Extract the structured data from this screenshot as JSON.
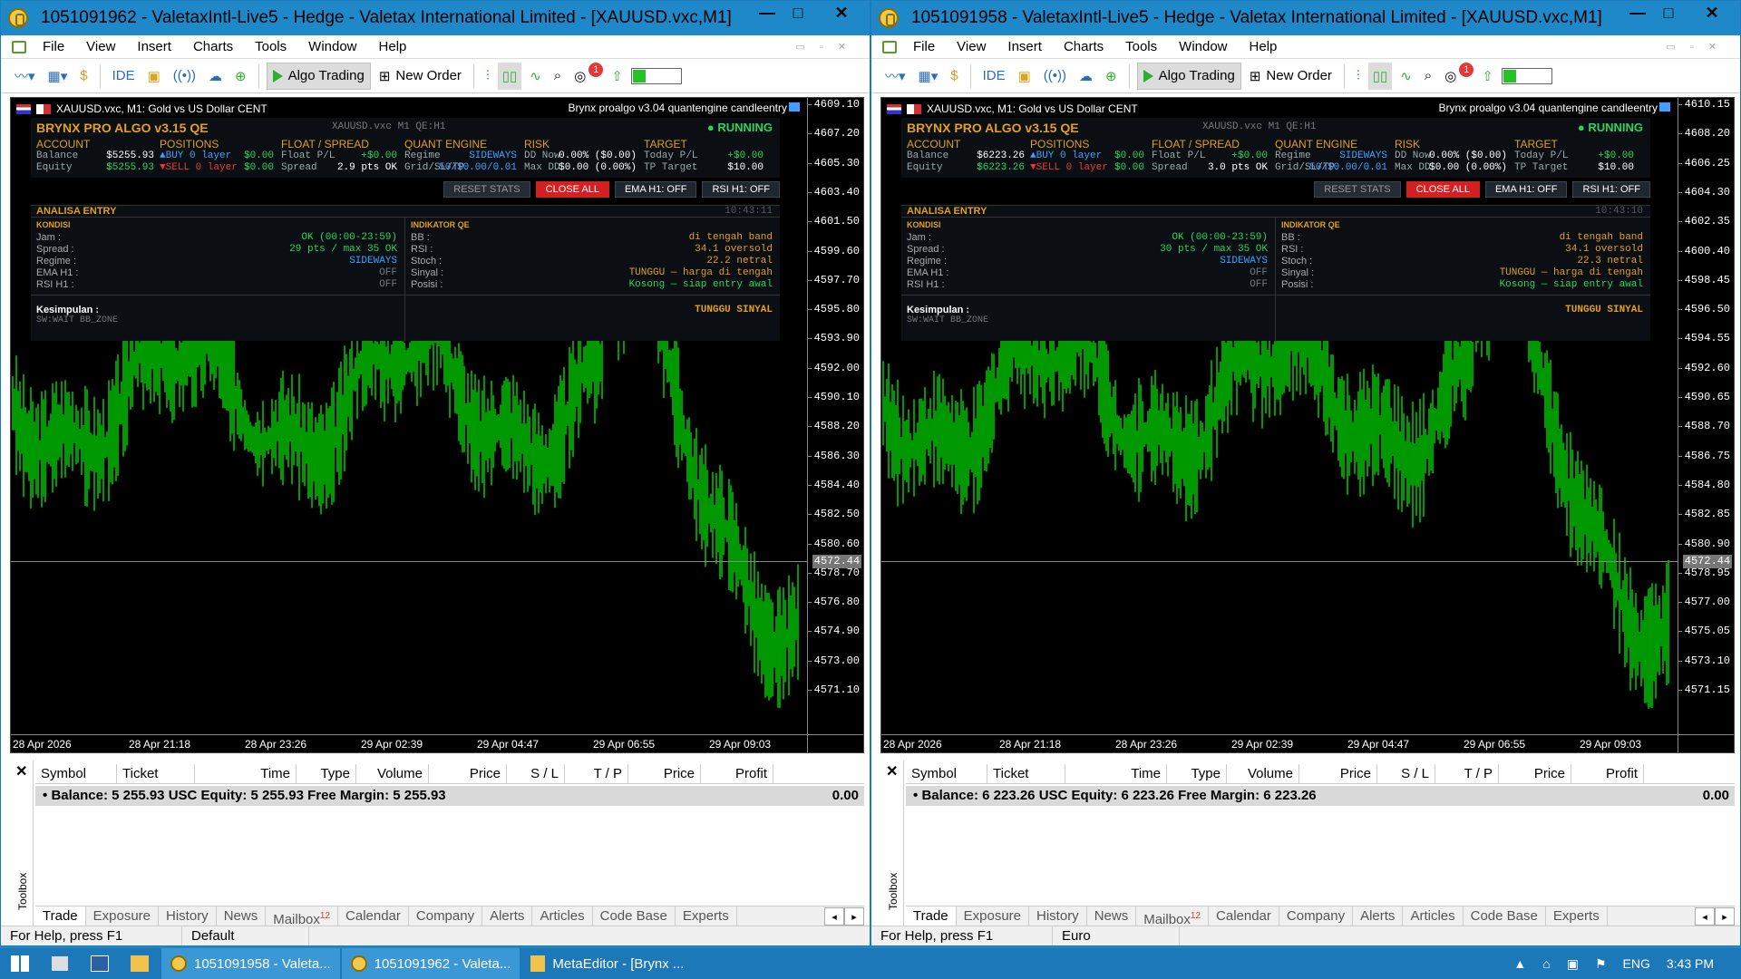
{
  "windows": [
    {
      "title": "1051091962 - ValetaxIntl-Live5 - Hedge - Valetax International Limited - [XAUUSD.vxc,M1]",
      "chart_header": "XAUUSD.vxc, M1:  Gold vs US Dollar CENT",
      "ea_name": "Brynx proalgo v3.04 quantengine candleentry",
      "status_help": "For Help, press F1",
      "status_profile": "Default",
      "current_price": "4572.44",
      "price_ticks": [
        "4609.10",
        "4607.20",
        "4605.30",
        "4603.40",
        "4601.50",
        "4599.60",
        "4597.70",
        "4595.80",
        "4593.90",
        "4592.00",
        "4590.10",
        "4588.20",
        "4586.30",
        "4584.40",
        "4582.50",
        "4580.60",
        "4578.70",
        "4576.80",
        "4574.90",
        "4573.00",
        "4571.10"
      ],
      "panel": {
        "title": "BRYNX PRO ALGO  v3.15 QE",
        "symbol_tf": "XAUUSD.vxc   M1   QE:H1",
        "status": "● RUNNING",
        "account_h": "ACCOUNT",
        "balance_l": "Balance",
        "balance": "$5255.93",
        "equity_l": "Equity",
        "equity": "$5255.93",
        "positions_h": "POSITIONS",
        "buy": "▲BUY   0 layer",
        "buy_v": "$0.00",
        "sell": "▼SELL  0 layer",
        "sell_v": "$0.00",
        "float_h": "FLOAT / SPREAD",
        "floatpl_l": "Float P/L",
        "floatpl": "+$0.00",
        "spread_l": "Spread",
        "spread": "2.9 pts OK",
        "quant_h": "QUANT ENGINE",
        "regime_l": "Regime",
        "regime": "SIDEWAYS",
        "grid_l": "Grid/SL/TP",
        "grid": "50/$0.00/0.01",
        "risk_h": "RISK",
        "ddnow_l": "DD Now",
        "ddnow": "0.00% ($0.00)",
        "maxdd_l": "Max DD",
        "maxdd": "$0.00 (0.00%)",
        "target_h": "TARGET",
        "today_l": "Today P/L",
        "today": "+$0.00",
        "tp_l": "TP Target",
        "tp": "$10.00",
        "btn_reset": "RESET STATS",
        "btn_close": "CLOSE ALL",
        "btn_ema": "EMA H1: OFF",
        "btn_rsi": "RSI H1: OFF",
        "entry_h": "ANALISA ENTRY",
        "entry_time": "10:43:11",
        "kondisi_h": "KONDISI",
        "jam_l": "Jam :",
        "jam": "OK (00:00-23:59)",
        "spread2_l": "Spread :",
        "spread2": "29 pts / max 35 OK",
        "regime2_l": "Regime :",
        "regime2": "SIDEWAYS",
        "emah1_l": "EMA H1 :",
        "emah1": "OFF",
        "rsih1_l": "RSI H1 :",
        "rsih1": "OFF",
        "indik_h": "INDIKATOR QE",
        "bb_l": "BB :",
        "bb": "di tengah band",
        "rsi_l": "RSI :",
        "rsi": "34.1 oversold",
        "stoch_l": "Stoch :",
        "stoch": "22.2 netral",
        "sinyal_l": "Sinyal :",
        "sinyal": "TUNGGU — harga di tengah",
        "posisi_l": "Posisi :",
        "posisi": "Kosong — siap entry awal",
        "kes_l": "Kesimpulan :",
        "kes": "SW:WAIT BB_ZONE",
        "tunggu": "TUNGGU SINYAL"
      },
      "balance_row": "Balance: 5 255.93 USC  Equity: 5 255.93  Free Margin: 5 255.93",
      "profit": "0.00"
    },
    {
      "title": "1051091958 - ValetaxIntl-Live5 - Hedge - Valetax International Limited - [XAUUSD.vxc,M1]",
      "chart_header": "XAUUSD.vxc, M1:  Gold vs US Dollar CENT",
      "ea_name": "Brynx proalgo v3.04 quantengine candleentry",
      "status_help": "For Help, press F1",
      "status_profile": "Euro",
      "current_price": "4572.44",
      "price_ticks": [
        "4610.15",
        "4608.20",
        "4606.25",
        "4604.30",
        "4602.35",
        "4600.40",
        "4598.45",
        "4596.50",
        "4594.55",
        "4592.60",
        "4590.65",
        "4588.70",
        "4586.75",
        "4584.80",
        "4582.85",
        "4580.90",
        "4578.95",
        "4577.00",
        "4575.05",
        "4573.10",
        "4571.15"
      ],
      "panel": {
        "title": "BRYNX PRO ALGO  v3.15 QE",
        "symbol_tf": "XAUUSD.vxc   M1   QE:H1",
        "status": "● RUNNING",
        "account_h": "ACCOUNT",
        "balance_l": "Balance",
        "balance": "$6223.26",
        "equity_l": "Equity",
        "equity": "$6223.26",
        "positions_h": "POSITIONS",
        "buy": "▲BUY   0 layer",
        "buy_v": "$0.00",
        "sell": "▼SELL  0 layer",
        "sell_v": "$0.00",
        "float_h": "FLOAT / SPREAD",
        "floatpl_l": "Float P/L",
        "floatpl": "+$0.00",
        "spread_l": "Spread",
        "spread": "3.0 pts OK",
        "quant_h": "QUANT ENGINE",
        "regime_l": "Regime",
        "regime": "SIDEWAYS",
        "grid_l": "Grid/SL/TP",
        "grid": "50/$0.00/0.01",
        "risk_h": "RISK",
        "ddnow_l": "DD Now",
        "ddnow": "0.00% ($0.00)",
        "maxdd_l": "Max DD",
        "maxdd": "$0.00 (0.00%)",
        "target_h": "TARGET",
        "today_l": "Today P/L",
        "today": "+$0.00",
        "tp_l": "TP Target",
        "tp": "$10.00",
        "btn_reset": "RESET STATS",
        "btn_close": "CLOSE ALL",
        "btn_ema": "EMA H1: OFF",
        "btn_rsi": "RSI H1: OFF",
        "entry_h": "ANALISA ENTRY",
        "entry_time": "10:43:10",
        "kondisi_h": "KONDISI",
        "jam_l": "Jam :",
        "jam": "OK (00:00-23:59)",
        "spread2_l": "Spread :",
        "spread2": "30 pts / max 35 OK",
        "regime2_l": "Regime :",
        "regime2": "SIDEWAYS",
        "emah1_l": "EMA H1 :",
        "emah1": "OFF",
        "rsih1_l": "RSI H1 :",
        "rsih1": "OFF",
        "indik_h": "INDIKATOR QE",
        "bb_l": "BB :",
        "bb": "di tengah band",
        "rsi_l": "RSI :",
        "rsi": "34.1 oversold",
        "stoch_l": "Stoch :",
        "stoch": "22.3 netral",
        "sinyal_l": "Sinyal :",
        "sinyal": "TUNGGU — harga di tengah",
        "posisi_l": "Posisi :",
        "posisi": "Kosong — siap entry awal",
        "kes_l": "Kesimpulan :",
        "kes": "SW:WAIT BB_ZONE",
        "tunggu": "TUNGGU SINYAL"
      },
      "balance_row": "Balance: 6 223.26 USC  Equity: 6 223.26  Free Margin: 6 223.26",
      "profit": "0.00"
    }
  ],
  "menu": [
    "File",
    "View",
    "Insert",
    "Charts",
    "Tools",
    "Window",
    "Help"
  ],
  "toolbar": {
    "ide": "IDE",
    "algo": "Algo Trading",
    "new_order": "New Order",
    "mail_count": "1"
  },
  "time_ticks": [
    "28 Apr 2026",
    "28 Apr 21:18",
    "28 Apr 23:26",
    "29 Apr 02:39",
    "29 Apr 04:47",
    "29 Apr 06:55",
    "29 Apr 09:03"
  ],
  "grid_cols": [
    "Symbol",
    "Ticket",
    "Time",
    "Type",
    "Volume",
    "Price",
    "S / L",
    "T / P",
    "Price",
    "Profit"
  ],
  "tabs": [
    "Trade",
    "Exposure",
    "History",
    "News",
    "Mailbox",
    "Calendar",
    "Company",
    "Alerts",
    "Articles",
    "Code Base",
    "Experts"
  ],
  "mailbox_badge": "12",
  "toolbox_label": "Toolbox",
  "taskbar": {
    "items": [
      "1051091958 - Valeta...",
      "1051091962 - Valeta...",
      "MetaEditor - [Brynx ..."
    ],
    "lang": "ENG",
    "clock": "3:43 PM"
  },
  "colors": {
    "titlebar": "#1e88c8",
    "candle": "#00ff00",
    "accent_gold": "#e0a020",
    "running": "#25d55d",
    "close_btn": "#d32020"
  }
}
